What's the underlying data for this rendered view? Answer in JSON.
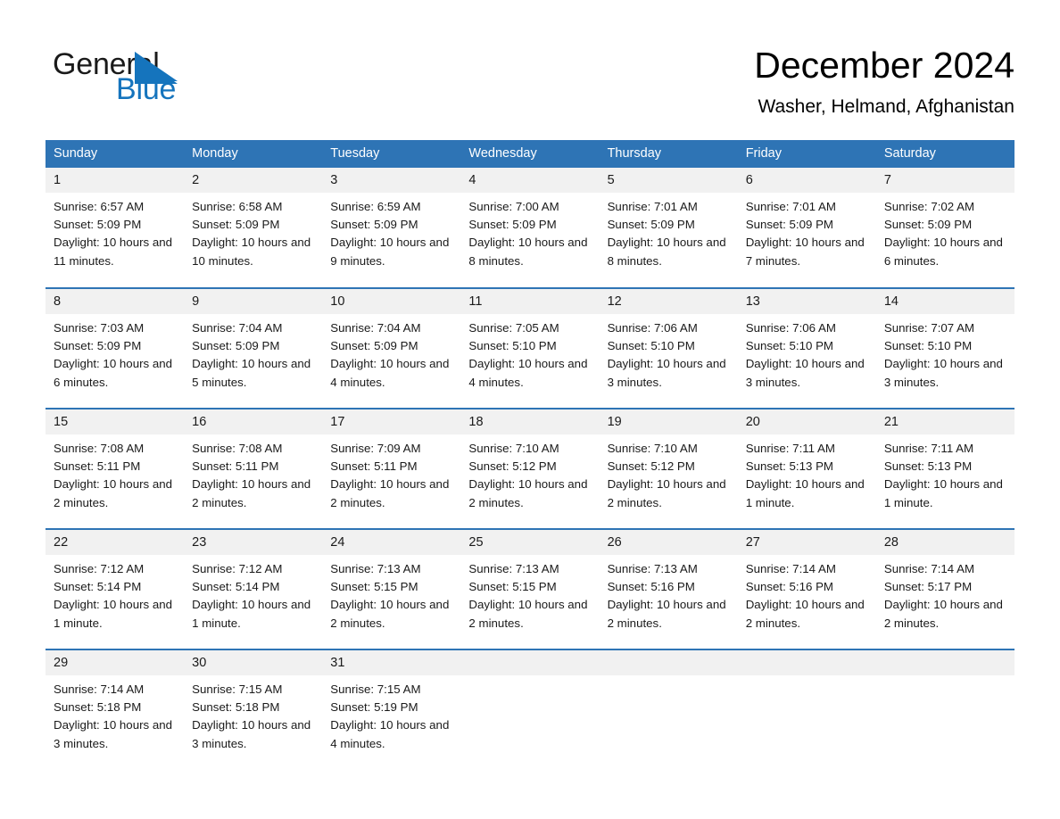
{
  "brand": {
    "word_one": "General",
    "word_two": "Blue",
    "triangle_color": "#1574bd",
    "text_color": "#1a1a1a"
  },
  "header": {
    "title": "December 2024",
    "subtitle": "Washer, Helmand, Afghanistan"
  },
  "theme": {
    "header_blue": "#2e74b5",
    "daynum_band": "#f1f1f1",
    "page_background": "#ffffff"
  },
  "calendar": {
    "weekdays": [
      "Sunday",
      "Monday",
      "Tuesday",
      "Wednesday",
      "Thursday",
      "Friday",
      "Saturday"
    ],
    "weeks": [
      [
        {
          "day": "1",
          "sunrise": "Sunrise: 6:57 AM",
          "sunset": "Sunset: 5:09 PM",
          "daylight": "Daylight: 10 hours and 11 minutes."
        },
        {
          "day": "2",
          "sunrise": "Sunrise: 6:58 AM",
          "sunset": "Sunset: 5:09 PM",
          "daylight": "Daylight: 10 hours and 10 minutes."
        },
        {
          "day": "3",
          "sunrise": "Sunrise: 6:59 AM",
          "sunset": "Sunset: 5:09 PM",
          "daylight": "Daylight: 10 hours and 9 minutes."
        },
        {
          "day": "4",
          "sunrise": "Sunrise: 7:00 AM",
          "sunset": "Sunset: 5:09 PM",
          "daylight": "Daylight: 10 hours and 8 minutes."
        },
        {
          "day": "5",
          "sunrise": "Sunrise: 7:01 AM",
          "sunset": "Sunset: 5:09 PM",
          "daylight": "Daylight: 10 hours and 8 minutes."
        },
        {
          "day": "6",
          "sunrise": "Sunrise: 7:01 AM",
          "sunset": "Sunset: 5:09 PM",
          "daylight": "Daylight: 10 hours and 7 minutes."
        },
        {
          "day": "7",
          "sunrise": "Sunrise: 7:02 AM",
          "sunset": "Sunset: 5:09 PM",
          "daylight": "Daylight: 10 hours and 6 minutes."
        }
      ],
      [
        {
          "day": "8",
          "sunrise": "Sunrise: 7:03 AM",
          "sunset": "Sunset: 5:09 PM",
          "daylight": "Daylight: 10 hours and 6 minutes."
        },
        {
          "day": "9",
          "sunrise": "Sunrise: 7:04 AM",
          "sunset": "Sunset: 5:09 PM",
          "daylight": "Daylight: 10 hours and 5 minutes."
        },
        {
          "day": "10",
          "sunrise": "Sunrise: 7:04 AM",
          "sunset": "Sunset: 5:09 PM",
          "daylight": "Daylight: 10 hours and 4 minutes."
        },
        {
          "day": "11",
          "sunrise": "Sunrise: 7:05 AM",
          "sunset": "Sunset: 5:10 PM",
          "daylight": "Daylight: 10 hours and 4 minutes."
        },
        {
          "day": "12",
          "sunrise": "Sunrise: 7:06 AM",
          "sunset": "Sunset: 5:10 PM",
          "daylight": "Daylight: 10 hours and 3 minutes."
        },
        {
          "day": "13",
          "sunrise": "Sunrise: 7:06 AM",
          "sunset": "Sunset: 5:10 PM",
          "daylight": "Daylight: 10 hours and 3 minutes."
        },
        {
          "day": "14",
          "sunrise": "Sunrise: 7:07 AM",
          "sunset": "Sunset: 5:10 PM",
          "daylight": "Daylight: 10 hours and 3 minutes."
        }
      ],
      [
        {
          "day": "15",
          "sunrise": "Sunrise: 7:08 AM",
          "sunset": "Sunset: 5:11 PM",
          "daylight": "Daylight: 10 hours and 2 minutes."
        },
        {
          "day": "16",
          "sunrise": "Sunrise: 7:08 AM",
          "sunset": "Sunset: 5:11 PM",
          "daylight": "Daylight: 10 hours and 2 minutes."
        },
        {
          "day": "17",
          "sunrise": "Sunrise: 7:09 AM",
          "sunset": "Sunset: 5:11 PM",
          "daylight": "Daylight: 10 hours and 2 minutes."
        },
        {
          "day": "18",
          "sunrise": "Sunrise: 7:10 AM",
          "sunset": "Sunset: 5:12 PM",
          "daylight": "Daylight: 10 hours and 2 minutes."
        },
        {
          "day": "19",
          "sunrise": "Sunrise: 7:10 AM",
          "sunset": "Sunset: 5:12 PM",
          "daylight": "Daylight: 10 hours and 2 minutes."
        },
        {
          "day": "20",
          "sunrise": "Sunrise: 7:11 AM",
          "sunset": "Sunset: 5:13 PM",
          "daylight": "Daylight: 10 hours and 1 minute."
        },
        {
          "day": "21",
          "sunrise": "Sunrise: 7:11 AM",
          "sunset": "Sunset: 5:13 PM",
          "daylight": "Daylight: 10 hours and 1 minute."
        }
      ],
      [
        {
          "day": "22",
          "sunrise": "Sunrise: 7:12 AM",
          "sunset": "Sunset: 5:14 PM",
          "daylight": "Daylight: 10 hours and 1 minute."
        },
        {
          "day": "23",
          "sunrise": "Sunrise: 7:12 AM",
          "sunset": "Sunset: 5:14 PM",
          "daylight": "Daylight: 10 hours and 1 minute."
        },
        {
          "day": "24",
          "sunrise": "Sunrise: 7:13 AM",
          "sunset": "Sunset: 5:15 PM",
          "daylight": "Daylight: 10 hours and 2 minutes."
        },
        {
          "day": "25",
          "sunrise": "Sunrise: 7:13 AM",
          "sunset": "Sunset: 5:15 PM",
          "daylight": "Daylight: 10 hours and 2 minutes."
        },
        {
          "day": "26",
          "sunrise": "Sunrise: 7:13 AM",
          "sunset": "Sunset: 5:16 PM",
          "daylight": "Daylight: 10 hours and 2 minutes."
        },
        {
          "day": "27",
          "sunrise": "Sunrise: 7:14 AM",
          "sunset": "Sunset: 5:16 PM",
          "daylight": "Daylight: 10 hours and 2 minutes."
        },
        {
          "day": "28",
          "sunrise": "Sunrise: 7:14 AM",
          "sunset": "Sunset: 5:17 PM",
          "daylight": "Daylight: 10 hours and 2 minutes."
        }
      ],
      [
        {
          "day": "29",
          "sunrise": "Sunrise: 7:14 AM",
          "sunset": "Sunset: 5:18 PM",
          "daylight": "Daylight: 10 hours and 3 minutes."
        },
        {
          "day": "30",
          "sunrise": "Sunrise: 7:15 AM",
          "sunset": "Sunset: 5:18 PM",
          "daylight": "Daylight: 10 hours and 3 minutes."
        },
        {
          "day": "31",
          "sunrise": "Sunrise: 7:15 AM",
          "sunset": "Sunset: 5:19 PM",
          "daylight": "Daylight: 10 hours and 4 minutes."
        },
        {
          "day": "",
          "sunrise": "",
          "sunset": "",
          "daylight": ""
        },
        {
          "day": "",
          "sunrise": "",
          "sunset": "",
          "daylight": ""
        },
        {
          "day": "",
          "sunrise": "",
          "sunset": "",
          "daylight": ""
        },
        {
          "day": "",
          "sunrise": "",
          "sunset": "",
          "daylight": ""
        }
      ]
    ]
  }
}
